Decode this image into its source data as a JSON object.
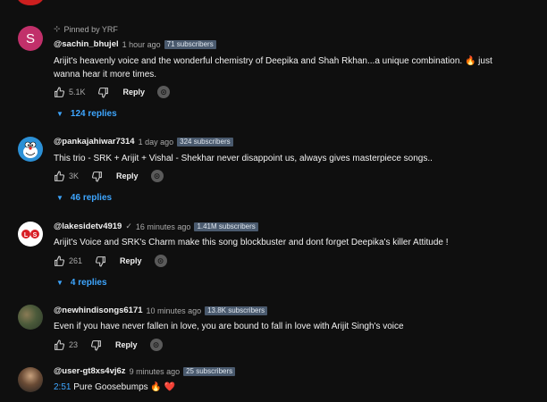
{
  "comments": [
    {
      "pinned_label": "Pinned by YRF",
      "avatar_letter": "S",
      "handle": "@sachin_bhujel",
      "time": "1 hour ago",
      "subscribers": "71 subscribers",
      "text": "Arijit's heavenly voice and the wonderful chemistry of Deepika and Shah Rkhan...a unique combination. 🔥 just wanna hear it more times.",
      "likes": "5.1K",
      "reply_label": "Reply",
      "replies_label": "124 replies"
    },
    {
      "handle": "@pankajahiwar7314",
      "time": "1 day ago",
      "subscribers": "324 subscribers",
      "text": "This trio - SRK + Arijit + Vishal - Shekhar never disappoint us, always gives masterpiece songs..",
      "likes": "3K",
      "reply_label": "Reply",
      "replies_label": "46 replies"
    },
    {
      "handle": "@lakesidetv4919",
      "verified": "✓",
      "time": "16 minutes ago",
      "subscribers": "1.41M subscribers",
      "avatar_text": "L S",
      "text": "Arijit's Voice and SRK's Charm make this song blockbuster and dont forget Deepika's killer Attitude !",
      "likes": "261",
      "reply_label": "Reply",
      "replies_label": "4 replies"
    },
    {
      "handle": "@newhindisongs6171",
      "time": "10 minutes ago",
      "subscribers": "13.8K subscribers",
      "text": "Even if you have never fallen in love, you are bound to fall in love with Arijit Singh's voice",
      "likes": "23",
      "reply_label": "Reply"
    },
    {
      "handle": "@user-gt8xs4vj6z",
      "time": "9 minutes ago",
      "subscribers": "25 subscribers",
      "timestamp_link": "2:51",
      "text": "Pure Goosebumps",
      "emoji_fire": "🔥",
      "emoji_heart": "❤️"
    }
  ],
  "colors": {
    "background": "#0f0f0f",
    "link": "#3ea6ff",
    "subs_badge": "#4a5a6e"
  },
  "icons": {
    "like": "thumbs-up-icon",
    "dislike": "thumbs-down-icon",
    "thanks": "super-thanks-icon",
    "pin": "pin-icon",
    "chevron": "chevron-down-icon"
  }
}
